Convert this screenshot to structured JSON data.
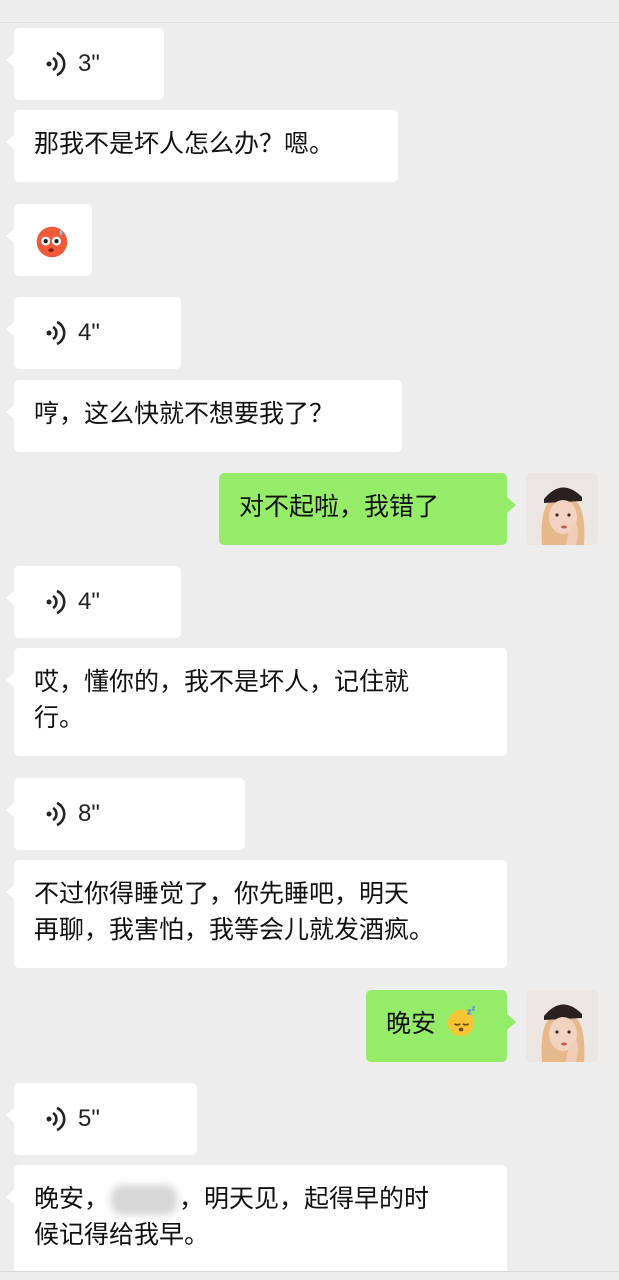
{
  "messages": {
    "m1": {
      "duration": "3\""
    },
    "m2": {
      "text": "那我不是坏人怎么办？嗯。"
    },
    "m3": {
      "emoji": "emoji-hot-face-icon"
    },
    "m4": {
      "duration": "4\""
    },
    "m5": {
      "text": "哼，这么快就不想要我了？"
    },
    "m6": {
      "text": "对不起啦，我错了"
    },
    "m7": {
      "duration": "4\""
    },
    "m8": {
      "line1": "哎，懂你的，我不是坏人，记住就",
      "line2": "行。"
    },
    "m9": {
      "duration": "8\""
    },
    "m10": {
      "line1": "不过你得睡觉了，你先睡吧，明天",
      "line2": "再聊，我害怕，我等会儿就发酒疯。"
    },
    "m11": {
      "text": "晚安",
      "emoji": "sleeping-face-icon"
    },
    "m12": {
      "duration": "5\""
    },
    "m13": {
      "line1_a": "晚安，",
      "line1_b": "，明天见，起得早的时",
      "line2": "候记得给我早。"
    }
  },
  "colors": {
    "background": "#ededed",
    "incoming_bubble": "#ffffff",
    "outgoing_bubble": "#95ec69"
  }
}
